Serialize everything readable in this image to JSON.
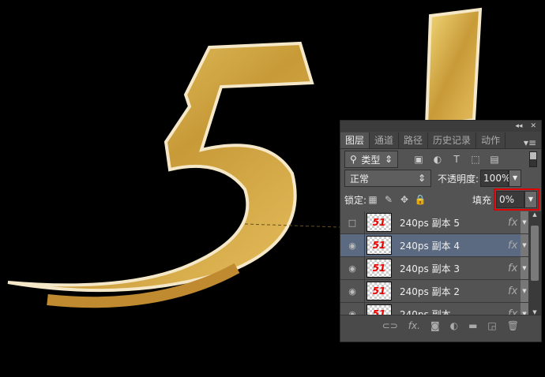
{
  "panel": {
    "collapse_icon": "◂◂",
    "close_icon": "✕",
    "tabs": [
      "图层",
      "通道",
      "路径",
      "历史记录",
      "动作"
    ],
    "filter": {
      "label": "类型"
    },
    "blend_mode": "正常",
    "opacity": {
      "label": "不透明度:",
      "value": "100%"
    },
    "lock": {
      "label": "锁定:"
    },
    "fill": {
      "label": "填充",
      "value": "0%"
    },
    "layers": [
      {
        "name": "240ps 副本 5",
        "visible": false,
        "selected": false
      },
      {
        "name": "240ps 副本 4",
        "visible": true,
        "selected": true
      },
      {
        "name": "240ps 副本 3",
        "visible": true,
        "selected": false
      },
      {
        "name": "240ps 副本 2",
        "visible": true,
        "selected": false
      },
      {
        "name": "240ps 副本",
        "visible": true,
        "selected": false
      }
    ],
    "thumb_text": "51",
    "fx_label": "fx"
  },
  "colors": {
    "highlight": "#e00000",
    "gold": "#d8b040"
  }
}
